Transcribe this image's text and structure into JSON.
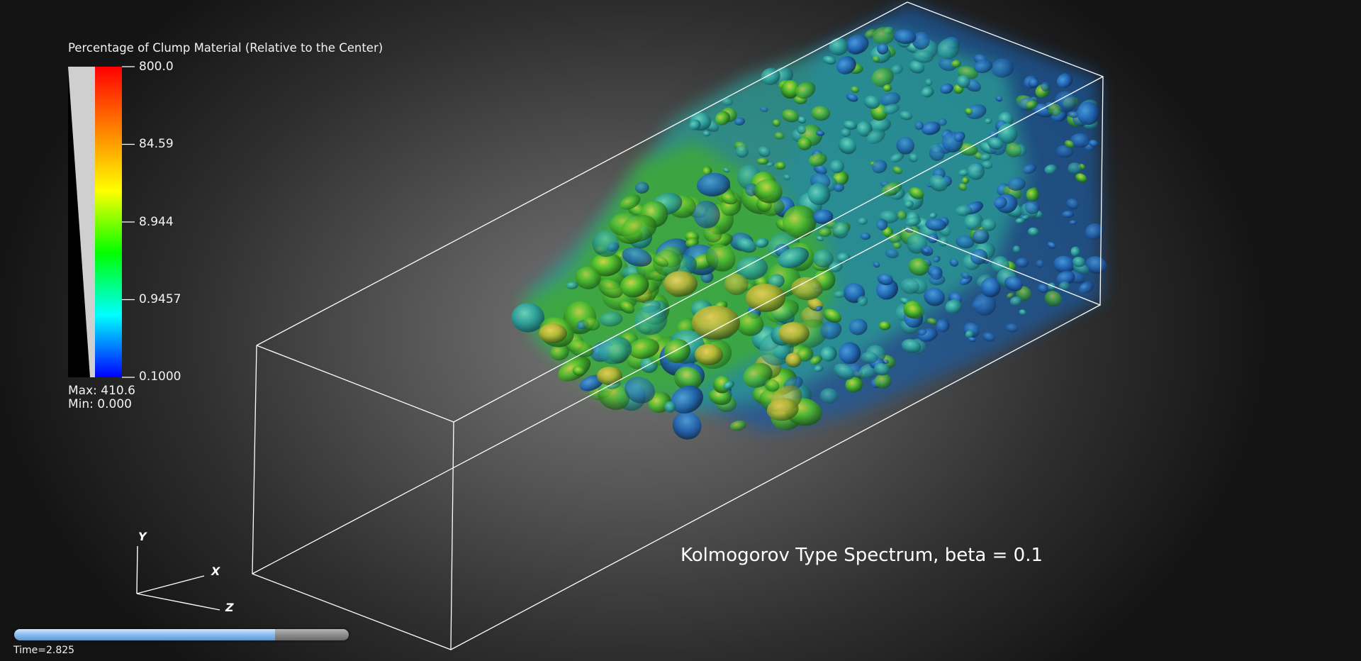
{
  "legend": {
    "title": "Percentage of Clump Material (Relative to the Center)",
    "ticks": [
      "800.0",
      "84.59",
      "8.944",
      "0.9457",
      "0.1000"
    ],
    "max_label": "Max:  410.6",
    "min_label": "Min:  0.000",
    "colors": [
      "#ff0000",
      "#ff8000",
      "#ffff00",
      "#00ff00",
      "#00ffff",
      "#0000ff"
    ]
  },
  "axes": {
    "x": "X",
    "y": "Y",
    "z": "Z"
  },
  "annotation": "Kolmogorov Type Spectrum, beta = 0.1",
  "time": {
    "label": "Time=2.825",
    "progress": 0.78
  },
  "volume_colors": {
    "green": "#3fc52a",
    "yellow": "#c9c43c",
    "cyan": "#2aa5a0",
    "blue": "#1f5fb5"
  }
}
